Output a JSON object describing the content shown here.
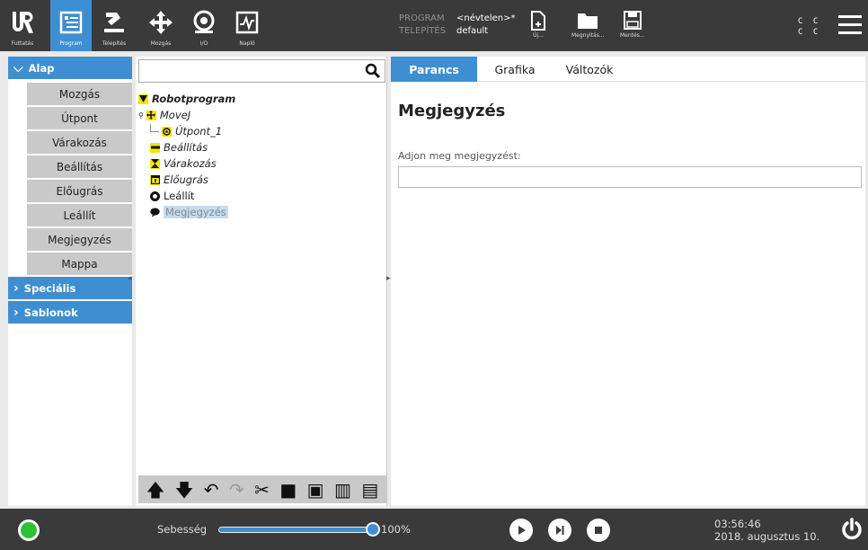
{
  "topbar": {
    "logo": "UR",
    "tabs": [
      {
        "label": "Futtatás",
        "icon": "run-icon"
      },
      {
        "label": "Program",
        "icon": "program-icon"
      },
      {
        "label": "Telepítés",
        "icon": "installation-icon"
      },
      {
        "label": "Mozgás",
        "icon": "move-icon"
      },
      {
        "label": "I/O",
        "icon": "io-icon"
      },
      {
        "label": "Napló",
        "icon": "log-icon"
      }
    ],
    "program_key": "PROGRAM",
    "program_value": "<névtelen>*",
    "install_key": "TELEPÍTÉS",
    "install_value": "default",
    "file_new": "Új...",
    "file_open": "Megnyitás...",
    "file_save": "Mentés...",
    "cc_top": "C C",
    "cc_bottom": "C C"
  },
  "left": {
    "category_basic": "Alap",
    "items": [
      "Mozgás",
      "Útpont",
      "Várakozás",
      "Beállítás",
      "Előugrás",
      "Leállít",
      "Megjegyzés",
      "Mappa"
    ],
    "category_special": "Speciális",
    "category_templates": "Sablonok"
  },
  "tree": {
    "search_placeholder": "",
    "root": "Robotprogram",
    "movej": "MoveJ",
    "waypoint": "Útpont_1",
    "set": "Beállítás",
    "wait": "Várakozás",
    "popup": "Előugrás",
    "halt": "Leállít",
    "comment": "Megjegyzés"
  },
  "right": {
    "tabs": [
      "Parancs",
      "Grafika",
      "Változók"
    ],
    "title": "Megjegyzés",
    "input_label": "Adjon meg megjegyzést:",
    "input_value": ""
  },
  "bottom": {
    "speed_label": "Sebesség",
    "speed_value": "100%",
    "speed_fraction": 1.0,
    "time": "03:56:46",
    "date": "2018. augusztus 10."
  },
  "colors": {
    "accent": "#3e8fd2",
    "bar": "#3a3a3a",
    "status_ok": "#2fc034",
    "node_yellow": "#f7e400"
  }
}
